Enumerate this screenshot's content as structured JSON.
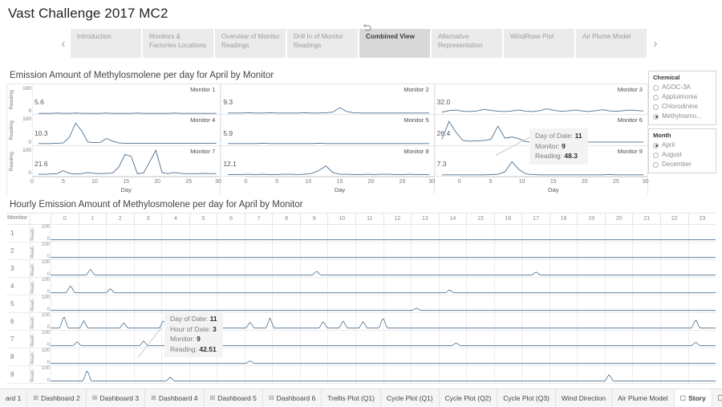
{
  "header": {
    "title": "Vast Challenge 2017 MC2"
  },
  "story_nav": {
    "prev_arrow": "‹",
    "next_arrow": "›",
    "revert_icon": "revert-icon",
    "tabs": [
      {
        "label": "Introduction",
        "active": false
      },
      {
        "label": "Monitors & Factories Locations",
        "active": false
      },
      {
        "label": "Overview of Monitor Readings",
        "active": false
      },
      {
        "label": "Drill In of Monitor Readings",
        "active": false
      },
      {
        "label": "Combined View",
        "active": true
      },
      {
        "label": "Alternative Representation",
        "active": false
      },
      {
        "label": "WindRose Plot",
        "active": false
      },
      {
        "label": "Air Plume Model",
        "active": false
      }
    ]
  },
  "daily_chart": {
    "title": "Emission Amount of Methylosmolene per day for April by Monitor",
    "y_axis_label": "Reading",
    "x_axis_label": "Day",
    "y_ticks": [
      "100",
      "0"
    ],
    "x_ticks": [
      "0",
      "5",
      "10",
      "15",
      "20",
      "25",
      "30"
    ],
    "columns": [
      {
        "panels": [
          {
            "monitor": "Monitor 1",
            "ref_value": "5.6"
          },
          {
            "monitor": "Monitor 4",
            "ref_value": "10.3"
          },
          {
            "monitor": "Monitor 7",
            "ref_value": "21.6"
          }
        ]
      },
      {
        "panels": [
          {
            "monitor": "Monitor 2",
            "ref_value": "9.3"
          },
          {
            "monitor": "Monitor 5",
            "ref_value": "5.9"
          },
          {
            "monitor": "Monitor 8",
            "ref_value": "12.1"
          }
        ]
      },
      {
        "panels": [
          {
            "monitor": "Monitor 3",
            "ref_value": "32.0"
          },
          {
            "monitor": "Monitor 6",
            "ref_value": "26.4"
          },
          {
            "monitor": "Monitor 9",
            "ref_value": "7.3"
          }
        ]
      }
    ]
  },
  "daily_tooltip": {
    "rows": [
      {
        "label": "Day of Date:",
        "value": "11"
      },
      {
        "label": "Monitor:",
        "value": "9"
      },
      {
        "label": "Reading:",
        "value": "48.3"
      }
    ]
  },
  "hourly_chart": {
    "title": "Hourly Emission Amount of Methylosmolene per day for April by Monitor",
    "corner_label": "Monitor",
    "y_axis_label": "Readi..",
    "y_ticks": [
      "100",
      "0"
    ],
    "hours": [
      "0",
      "1",
      "2",
      "3",
      "4",
      "5",
      "6",
      "7",
      "8",
      "9",
      "10",
      "11",
      "12",
      "13",
      "14",
      "15",
      "16",
      "17",
      "18",
      "19",
      "20",
      "21",
      "22",
      "23"
    ],
    "monitors": [
      "1",
      "2",
      "3",
      "4",
      "5",
      "6",
      "7",
      "8",
      "9"
    ]
  },
  "hourly_tooltip": {
    "rows": [
      {
        "label": "Day of Date:",
        "value": "11"
      },
      {
        "label": "Hour of Date:",
        "value": "3"
      },
      {
        "label": "Monitor:",
        "value": "9"
      },
      {
        "label": "Reading:",
        "value": "42.51"
      }
    ]
  },
  "filters": [
    {
      "title": "Chemical",
      "options": [
        {
          "label": "AGOC-3A",
          "selected": false
        },
        {
          "label": "Appluimonia",
          "selected": false
        },
        {
          "label": "Chlorodinine",
          "selected": false
        },
        {
          "label": "Methylosmo...",
          "selected": true
        }
      ]
    },
    {
      "title": "Month",
      "options": [
        {
          "label": "April",
          "selected": true
        },
        {
          "label": "August",
          "selected": false
        },
        {
          "label": "December",
          "selected": false
        }
      ]
    }
  ],
  "sheet_bar": {
    "sheets": [
      {
        "label": "ard 1",
        "icon": "",
        "active": false
      },
      {
        "label": "Dashboard 2",
        "icon": "⊞",
        "active": false
      },
      {
        "label": "Dashboard 3",
        "icon": "⊞",
        "active": false
      },
      {
        "label": "Dashboard 4",
        "icon": "⊞",
        "active": false
      },
      {
        "label": "Dashboard 5",
        "icon": "⊞",
        "active": false
      },
      {
        "label": "Dashboard 6",
        "icon": "⊟",
        "active": false
      },
      {
        "label": "Trellis Plot (Q1)",
        "icon": "",
        "active": false
      },
      {
        "label": "Cycle Plot (Q1)",
        "icon": "",
        "active": false
      },
      {
        "label": "Cycle Plot (Q2)",
        "icon": "",
        "active": false
      },
      {
        "label": "Cycle Plot (Q3)",
        "icon": "",
        "active": false
      },
      {
        "label": "Wind Direction",
        "icon": "",
        "active": false
      },
      {
        "label": "Air Plume Model",
        "icon": "",
        "active": false
      },
      {
        "label": "Story",
        "icon": "▢",
        "active": true
      }
    ]
  },
  "colors": {
    "line": "#4a6f8f",
    "tab_active_bg": "#d8d8d8",
    "tab_bg": "#ebebeb",
    "tooltip_bg": "#f3f3f3"
  },
  "chart_data": {
    "type": "line",
    "title": "Emission Amount of Methylosmolene per day for April by Monitor",
    "xlabel": "Day",
    "ylabel": "Reading",
    "ylim": [
      0,
      100
    ],
    "xlim": [
      1,
      30
    ],
    "grid": false,
    "legend": "right",
    "x": [
      1,
      2,
      3,
      4,
      5,
      6,
      7,
      8,
      9,
      10,
      11,
      12,
      13,
      14,
      15,
      16,
      17,
      18,
      19,
      20,
      21,
      22,
      23,
      24,
      25,
      26,
      27,
      28,
      29,
      30
    ],
    "series": [
      {
        "name": "Monitor 1",
        "ref_value": 5.6,
        "values": [
          3,
          3,
          3,
          4,
          3,
          3,
          4,
          3,
          3,
          3,
          3,
          4,
          3,
          3,
          3,
          3,
          4,
          3,
          3,
          3,
          3,
          3,
          4,
          3,
          3,
          3,
          3,
          3,
          3,
          3
        ]
      },
      {
        "name": "Monitor 2",
        "ref_value": 9.3,
        "values": [
          4,
          4,
          4,
          5,
          4,
          4,
          5,
          4,
          4,
          4,
          4,
          5,
          4,
          4,
          5,
          7,
          22,
          9,
          5,
          4,
          4,
          4,
          4,
          4,
          4,
          4,
          4,
          4,
          4,
          4
        ]
      },
      {
        "name": "Monitor 3",
        "ref_value": 32.0,
        "values": [
          7,
          12,
          14,
          10,
          9,
          11,
          16,
          13,
          10,
          9,
          11,
          14,
          10,
          9,
          12,
          18,
          13,
          10,
          11,
          14,
          11,
          9,
          12,
          15,
          11,
          10,
          12,
          14,
          12,
          11
        ]
      },
      {
        "name": "Monitor 4",
        "ref_value": 10.3,
        "values": [
          4,
          4,
          4,
          5,
          6,
          25,
          72,
          46,
          9,
          7,
          8,
          21,
          12,
          6,
          5,
          5,
          5,
          5,
          5,
          5,
          5,
          5,
          5,
          5,
          5,
          5,
          5,
          5,
          5,
          5
        ]
      },
      {
        "name": "Monitor 5",
        "ref_value": 5.9,
        "values": [
          4,
          4,
          4,
          4,
          4,
          5,
          4,
          4,
          4,
          4,
          4,
          4,
          4,
          5,
          4,
          4,
          4,
          4,
          4,
          4,
          4,
          4,
          4,
          4,
          4,
          4,
          4,
          4,
          4,
          4
        ]
      },
      {
        "name": "Monitor 6",
        "ref_value": 26.4,
        "values": [
          18,
          78,
          42,
          14,
          12,
          13,
          14,
          18,
          62,
          22,
          26,
          20,
          10,
          9,
          9,
          9,
          9,
          9,
          9,
          9,
          9,
          9,
          9,
          9,
          9,
          9,
          9,
          9,
          9,
          9
        ]
      },
      {
        "name": "Monitor 7",
        "ref_value": 21.6,
        "values": [
          6,
          6,
          7,
          8,
          18,
          9,
          7,
          8,
          12,
          9,
          8,
          9,
          10,
          30,
          72,
          66,
          8,
          10,
          48,
          86,
          12,
          8,
          12,
          9,
          8,
          8,
          8,
          9,
          8,
          8
        ]
      },
      {
        "name": "Monitor 8",
        "ref_value": 12.1,
        "values": [
          5,
          5,
          5,
          6,
          5,
          6,
          5,
          5,
          6,
          6,
          5,
          6,
          9,
          18,
          34,
          12,
          6,
          6,
          5,
          5,
          6,
          5,
          6,
          6,
          5,
          5,
          6,
          5,
          5,
          5
        ]
      },
      {
        "name": "Monitor 9",
        "ref_value": 7.3,
        "values": [
          4,
          4,
          4,
          4,
          4,
          4,
          4,
          5,
          6,
          14,
          48,
          22,
          7,
          5,
          4,
          4,
          4,
          4,
          4,
          4,
          4,
          4,
          4,
          4,
          5,
          4,
          4,
          4,
          4,
          4
        ]
      }
    ]
  }
}
